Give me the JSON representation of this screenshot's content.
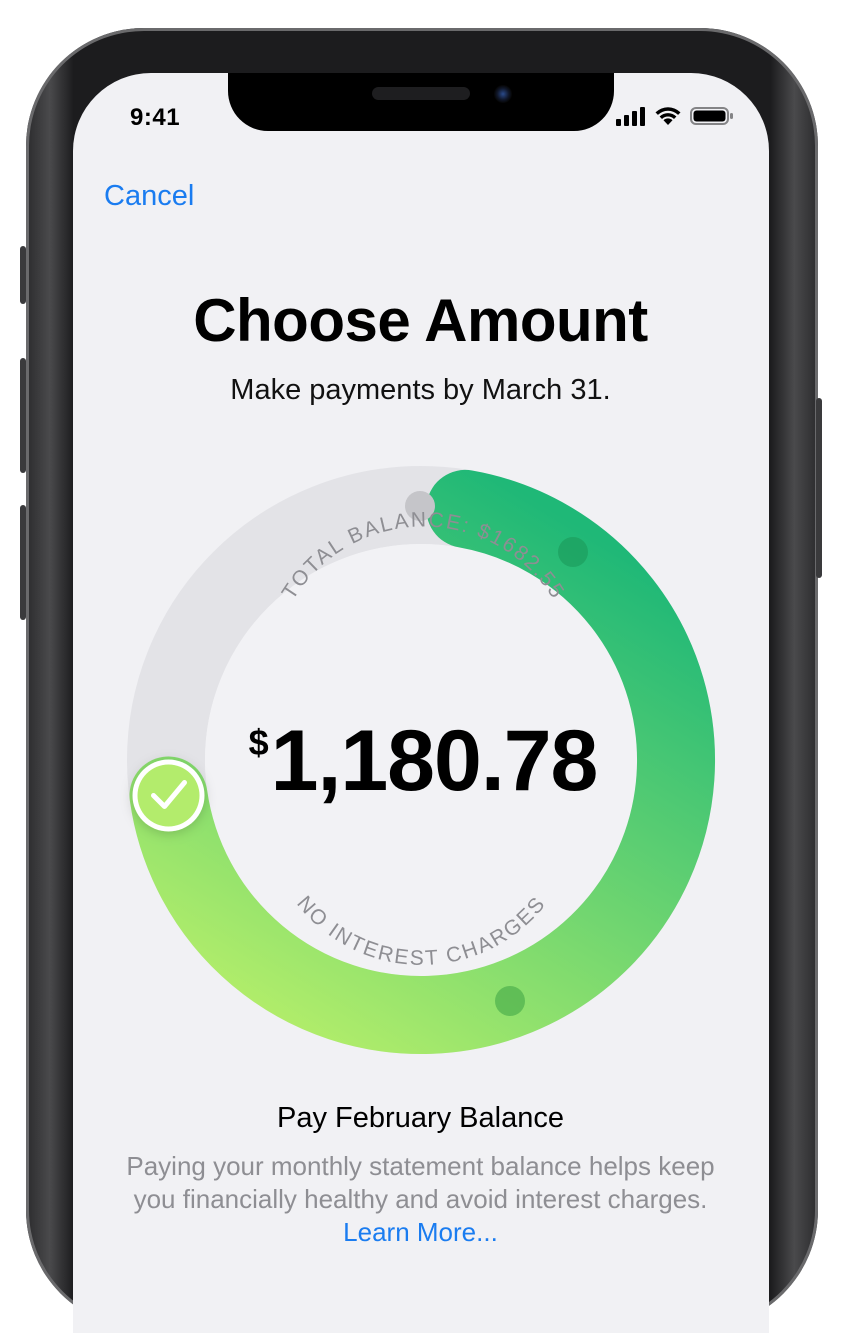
{
  "status": {
    "time": "9:41"
  },
  "nav": {
    "cancel_label": "Cancel"
  },
  "header": {
    "title": "Choose Amount",
    "subtitle": "Make payments by March 31."
  },
  "dial": {
    "top_label": "TOTAL BALANCE: $1682.55",
    "bottom_label": "NO INTEREST CHARGES",
    "currency_symbol": "$",
    "amount": "1,180.78",
    "selected_fraction": 0.7,
    "colors": {
      "green_start": "#b4ee6a",
      "green_end": "#1fb877",
      "track": "#e2e2e6"
    }
  },
  "option": {
    "title": "Pay February Balance",
    "description": "Paying your monthly statement balance helps keep you financially healthy and avoid interest charges.",
    "link_label": "Learn More..."
  },
  "colors": {
    "accent": "#1a7cf0"
  }
}
